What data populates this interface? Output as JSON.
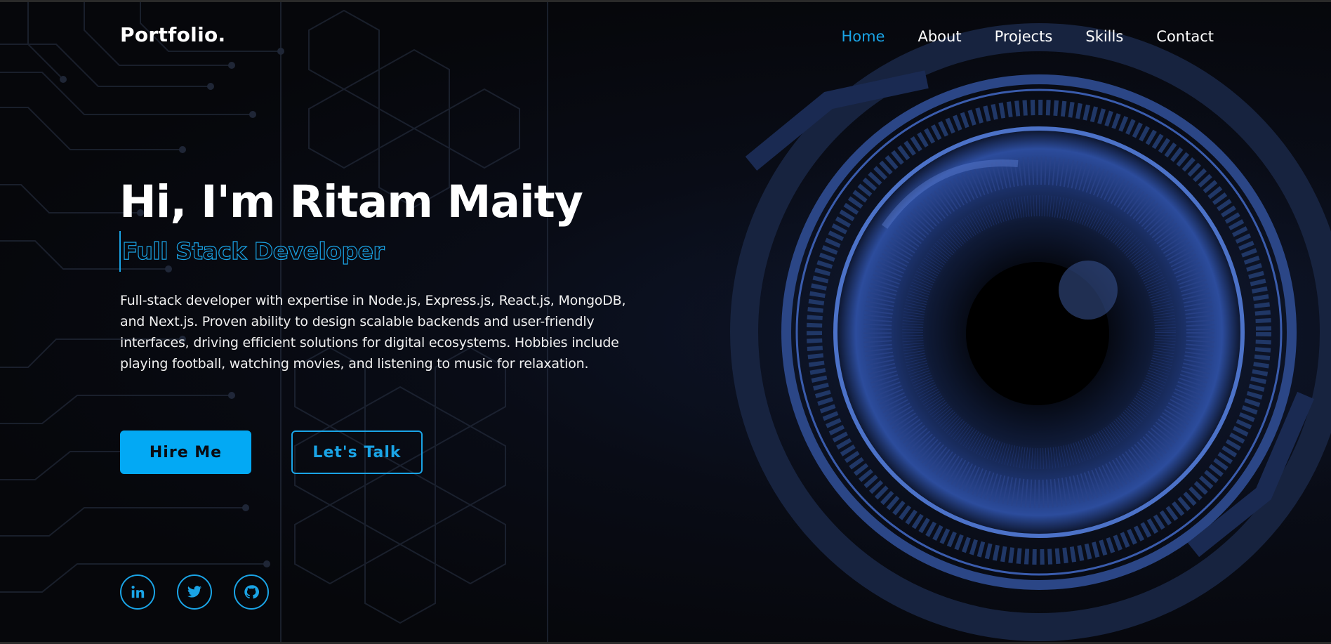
{
  "header": {
    "logo": "Portfolio.",
    "nav": [
      {
        "label": "Home",
        "active": true
      },
      {
        "label": "About",
        "active": false
      },
      {
        "label": "Projects",
        "active": false
      },
      {
        "label": "Skills",
        "active": false
      },
      {
        "label": "Contact",
        "active": false
      }
    ]
  },
  "hero": {
    "title": "Hi, I'm Ritam Maity",
    "role": "Full Stack Developer",
    "bio": "Full-stack developer with expertise in Node.js, Express.js, React.js, MongoDB, and Next.js. Proven ability to design scalable backends and user-friendly interfaces, driving efficient solutions for digital ecosystems. Hobbies include playing football, watching movies, and listening to music for relaxation.",
    "primary_button": "Hire Me",
    "secondary_button": "Let's Talk"
  },
  "socials": [
    {
      "icon": "linkedin-icon"
    },
    {
      "icon": "twitter-icon"
    },
    {
      "icon": "github-icon"
    }
  ],
  "colors": {
    "accent": "#1aa4e6",
    "button_fill": "#03a9f4",
    "background": "#06070b",
    "text": "#ffffff"
  }
}
